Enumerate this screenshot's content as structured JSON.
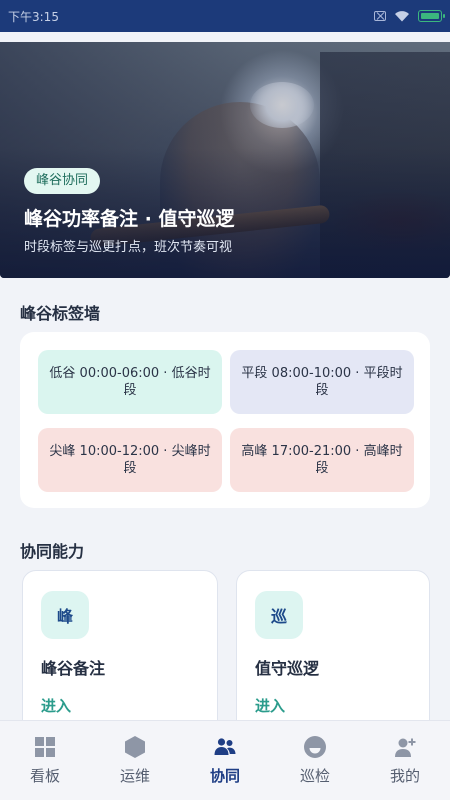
{
  "status_bar": {
    "time": "下午3:15"
  },
  "hero": {
    "tag": "峰谷协同",
    "title": "峰谷功率备注 · 值守巡逻",
    "subtitle": "时段标签与巡更打点，班次节奏可视"
  },
  "tag_wall": {
    "title": "峰谷标签墙",
    "cells": [
      {
        "text": "低谷 00:00-06:00 · 低谷时段",
        "color": "#daf5ef"
      },
      {
        "text": "平段 08:00-10:00 · 平段时段",
        "color": "#e4e7f5"
      },
      {
        "text": "尖峰 10:00-12:00 · 尖峰时段",
        "color": "#f9e1df"
      },
      {
        "text": "高峰 17:00-21:00 · 高峰时段",
        "color": "#f9e1df"
      }
    ]
  },
  "capabilities": {
    "title": "协同能力",
    "cards": [
      {
        "badge": "峰",
        "name": "峰谷备注",
        "action": "进入"
      },
      {
        "badge": "巡",
        "name": "值守巡逻",
        "action": "进入"
      }
    ]
  },
  "bottom_nav": {
    "items": [
      {
        "label": "看板",
        "icon": "grid-icon"
      },
      {
        "label": "运维",
        "icon": "hexagon-icon"
      },
      {
        "label": "协同",
        "icon": "people-icon",
        "active": true
      },
      {
        "label": "巡检",
        "icon": "smile-icon"
      },
      {
        "label": "我的",
        "icon": "person-add-icon"
      }
    ],
    "active_color": "#1f3e85"
  },
  "colors": {
    "header": "#1c3a7a",
    "accent": "#2b9c8c"
  }
}
